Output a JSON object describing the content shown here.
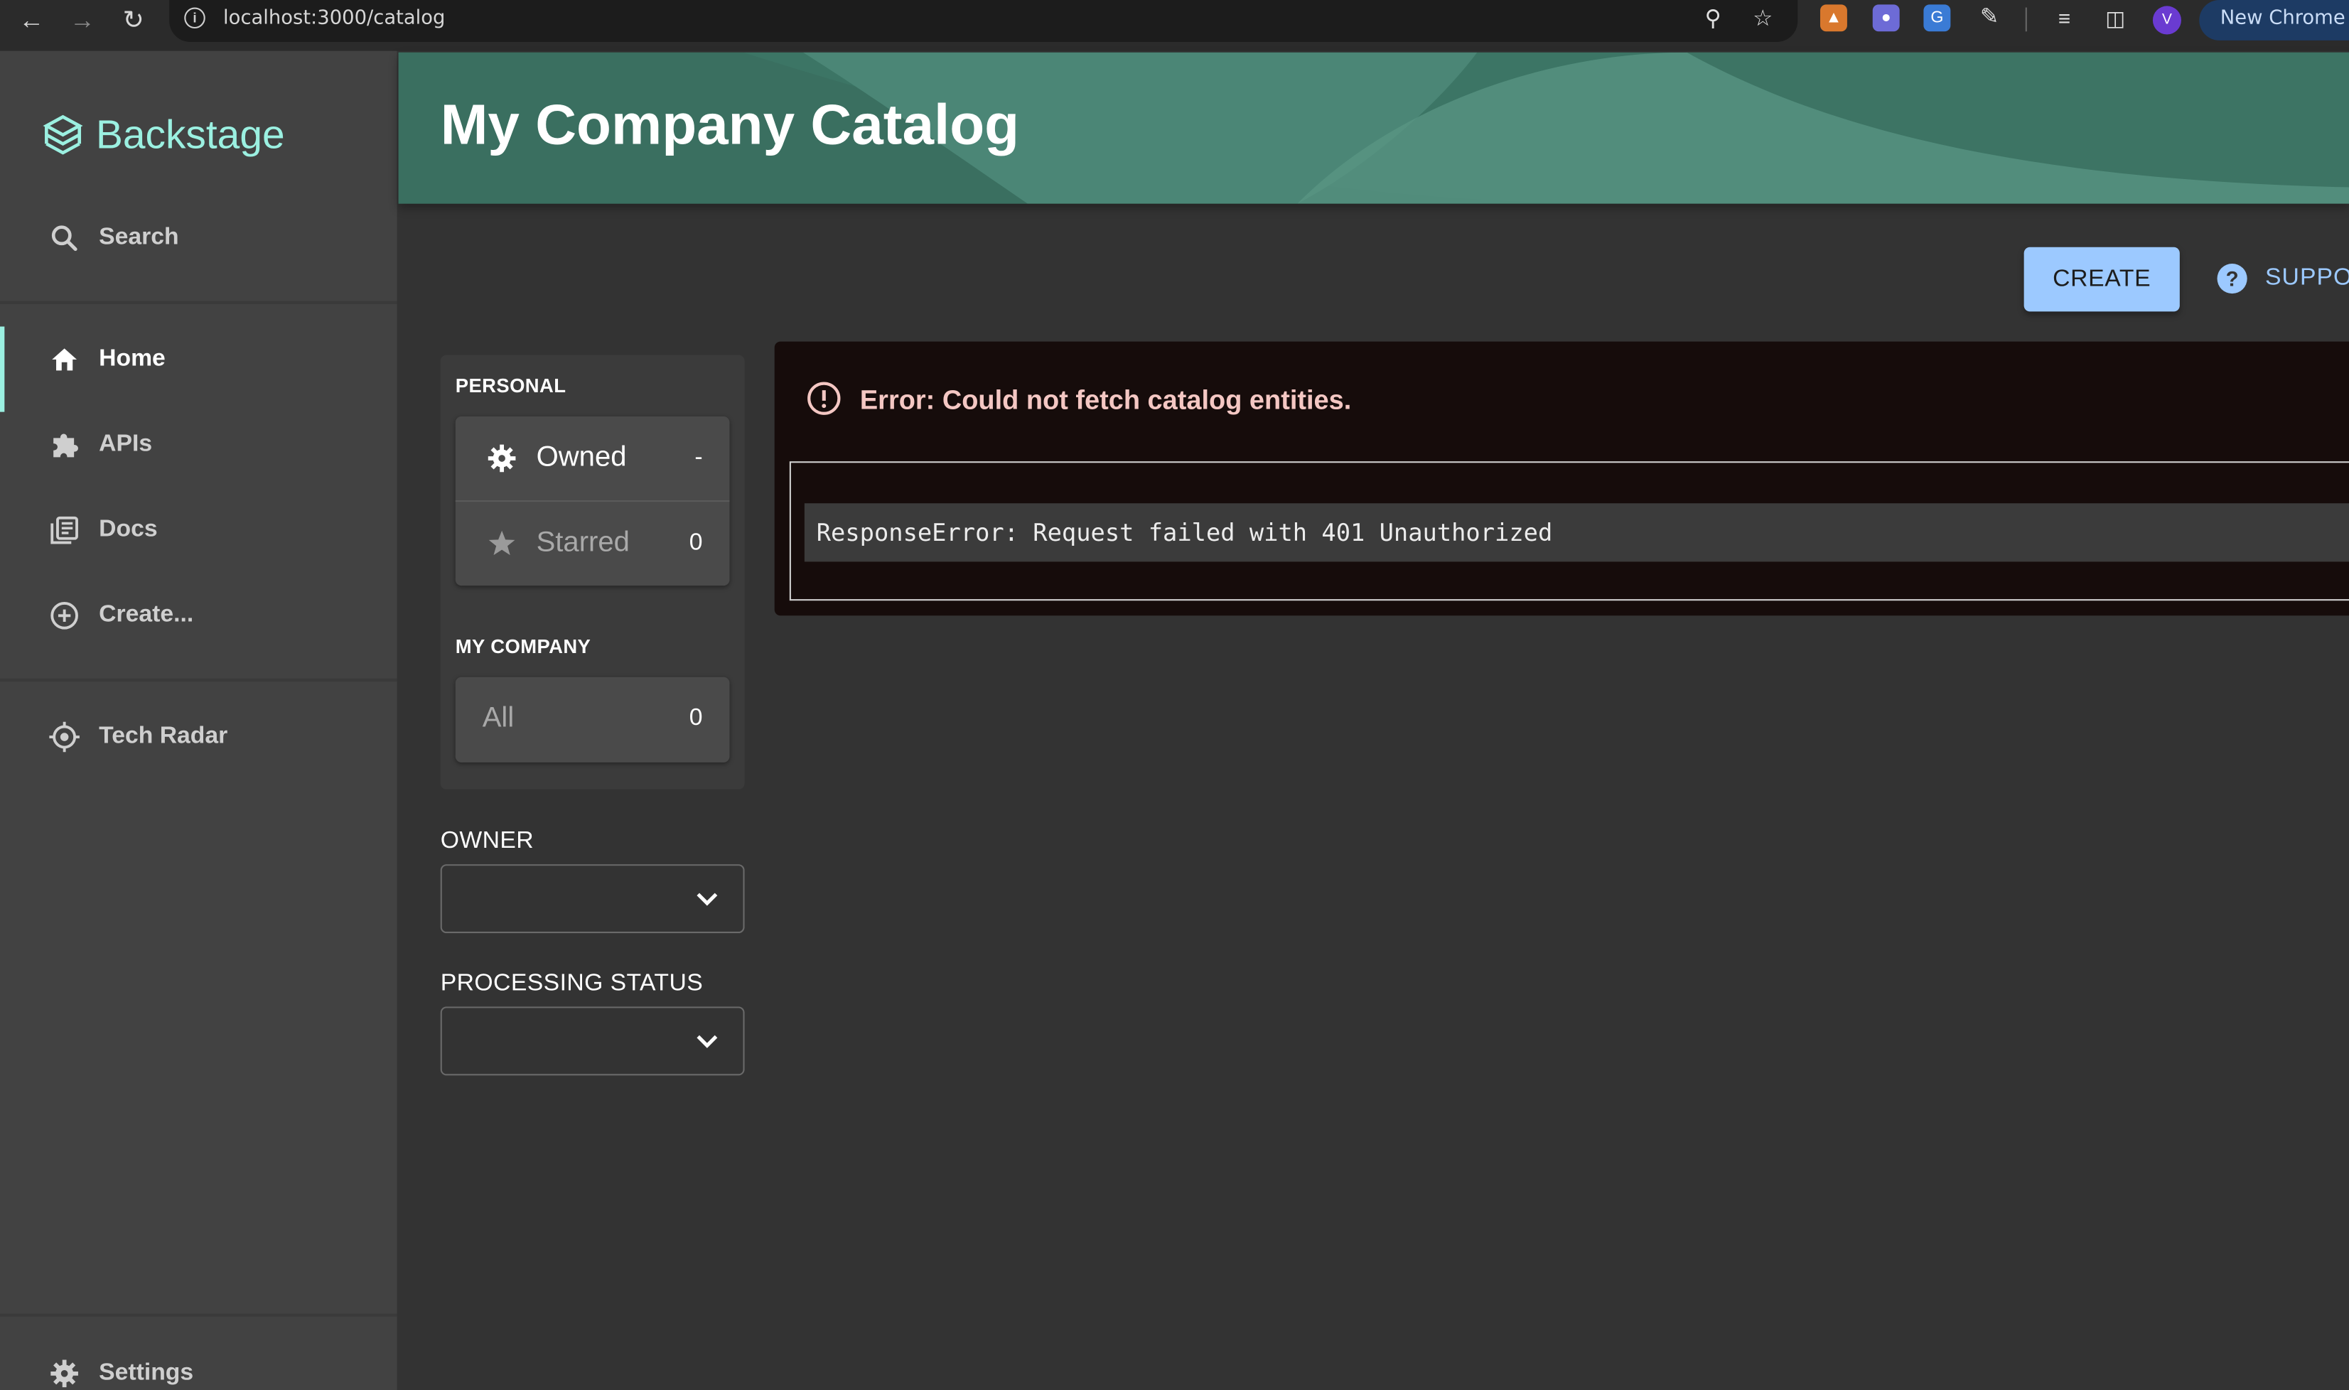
{
  "browser": {
    "url": "localhost:3000/catalog",
    "new_chrome_label": "New Chrome av",
    "profile_initial": "V"
  },
  "sidebar": {
    "logo_text": "Backstage",
    "search_label": "Search",
    "items": [
      {
        "label": "Home",
        "icon": "home-icon"
      },
      {
        "label": "APIs",
        "icon": "puzzle-icon"
      },
      {
        "label": "Docs",
        "icon": "library-icon"
      },
      {
        "label": "Create...",
        "icon": "add-circle-icon"
      }
    ],
    "tech_radar_label": "Tech Radar",
    "settings_label": "Settings",
    "accent_color": "#9bf0e1"
  },
  "header": {
    "title": "My Company Catalog"
  },
  "actions": {
    "create_label": "CREATE",
    "support_label": "SUPPORT"
  },
  "filters": {
    "personal_title": "PERSONAL",
    "owned_label": "Owned",
    "owned_count": "-",
    "starred_label": "Starred",
    "starred_count": "0",
    "company_title": "MY COMPANY",
    "all_label": "All",
    "all_count": "0",
    "owner_label": "OWNER",
    "processing_status_label": "PROCESSING STATUS"
  },
  "error": {
    "title": "Error: Could not fetch catalog entities.",
    "message": "ResponseError: Request failed with 401 Unauthorized"
  }
}
